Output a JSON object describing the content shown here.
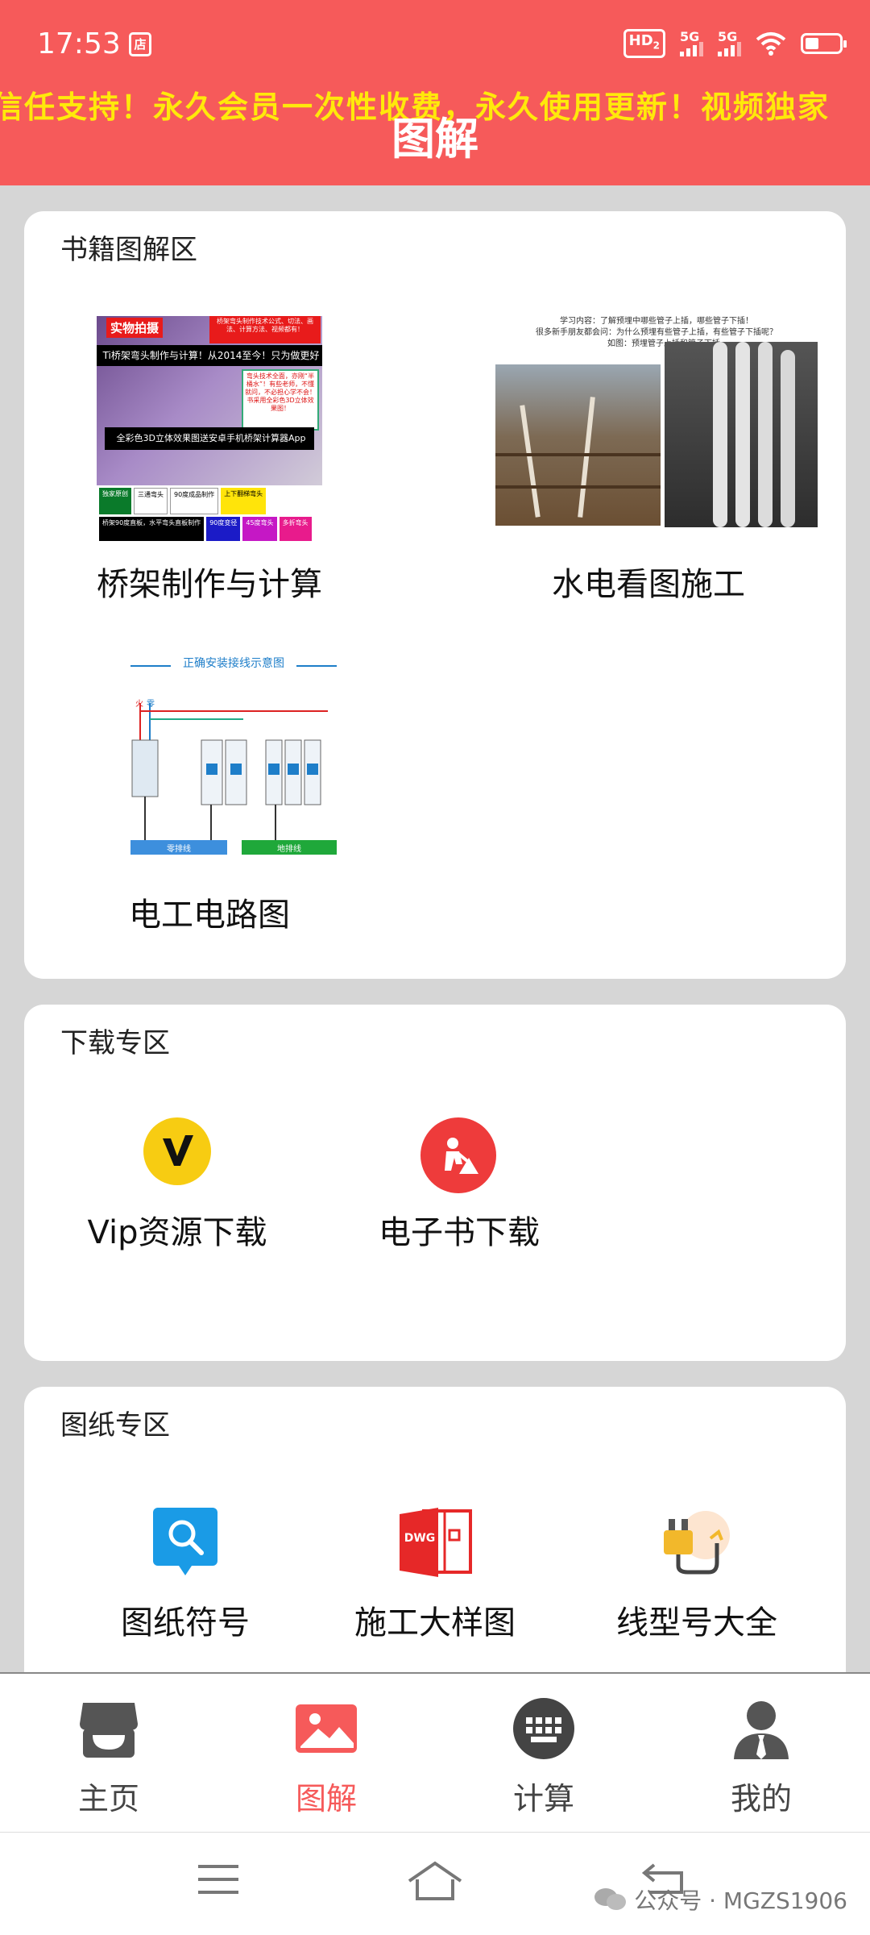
{
  "status_bar": {
    "time": "17:53",
    "store_glyph": "店",
    "hd_label": "HD",
    "hd_sub": "2",
    "signal1": "5G",
    "signal2": "5G"
  },
  "header": {
    "marquee": "信任支持！永久会员一次性收费，永久使用更新！视频独家",
    "title": "图解"
  },
  "books_section": {
    "title": "书籍图解区",
    "items": [
      {
        "label": "桥架制作与计算"
      },
      {
        "label": "水电看图施工"
      },
      {
        "label": "电工电路图"
      }
    ],
    "thumb1": {
      "tag": "实物拍摄",
      "banner": "桥架弯头制作技术公式、切法、画法、计算方法、视频都有！",
      "line1": "Ti桥架弯头制作与计算！从2014至今！只为做更好",
      "note": "弯头技术全面，亦刚“半桶水”！有些老师，不懂就问，不必担心学不会！书采用全彩色3D立体效果图！",
      "line2": "全彩色3D立体效果图送安卓手机桥架计算器App",
      "chips": [
        "独家原创",
        "三通弯头",
        "90度成品制作",
        "上下翻梯弯头",
        "桥架90度直板，水平弯头直板制作",
        "90度变径",
        "45度弯头",
        "多折弯头"
      ]
    },
    "thumb2": {
      "text1": "学习内容：了解预埋中哪些管子上插，哪些管子下插！",
      "text2": "很多新手朋友都会问：为什么预埋有些管子上插，有些管子下插呢？",
      "text3": "如图：预埋管子上插和管子下插"
    },
    "thumb3": {
      "title": "正确安装接线示意图",
      "fire": "火",
      "zero": "零",
      "bar1": "零排线",
      "bar2": "地排线"
    }
  },
  "download_section": {
    "title": "下载专区",
    "items": [
      {
        "label": "Vip资源下载",
        "icon": "vip-icon",
        "color": "#f7cc12"
      },
      {
        "label": "电子书下载",
        "icon": "worker-icon",
        "color": "#ee3b3b"
      }
    ]
  },
  "drawings_section": {
    "title": "图纸专区",
    "items": [
      {
        "label": "图纸符号",
        "icon": "search-doc-icon",
        "color": "#1a9be6"
      },
      {
        "label": "施工大样图",
        "icon": "dwg-icon",
        "icon_text": "DWG",
        "color": "#e62828"
      },
      {
        "label": "线型号大全",
        "icon": "plug-icon",
        "color": "#f2b82b"
      }
    ]
  },
  "bottom_nav": {
    "items": [
      {
        "label": "主页",
        "icon": "store-icon"
      },
      {
        "label": "图解",
        "icon": "image-icon"
      },
      {
        "label": "计算",
        "icon": "keyboard-icon"
      },
      {
        "label": "我的",
        "icon": "user-icon"
      }
    ],
    "active_color": "#f65a5a"
  },
  "watermark": "公众号 · MGZS1906"
}
